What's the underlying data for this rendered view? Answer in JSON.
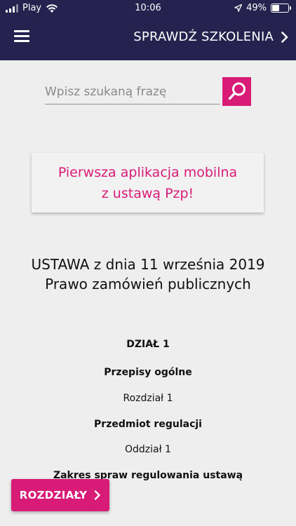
{
  "status_bar": {
    "carrier": "Play",
    "time": "10:06",
    "battery_percent": "49%",
    "battery_level": 0.49,
    "icons": [
      "signal-icon",
      "wifi-icon",
      "location-arrow-icon",
      "battery-icon"
    ]
  },
  "header": {
    "menu_icon": "hamburger-menu-icon",
    "check_trainings_label": "SPRAWDŹ SZKOLENIA",
    "chevron_icon": "chevron-right-icon"
  },
  "search": {
    "placeholder": "Wpisz szukaną frazę",
    "value": "",
    "button_icon": "search-icon"
  },
  "promo": {
    "line1": "Pierwsza aplikacja mobilna",
    "line2": "z ustawą Pzp!"
  },
  "document": {
    "title_line1": "USTAWA z dnia 11 września 2019",
    "title_line2": "Prawo zamówień publicznych",
    "section": "DZIAŁ 1",
    "section_title": "Przepisy ogólne",
    "chapter": "Rozdział 1",
    "chapter_title": "Przedmiot regulacji",
    "division": "Oddział 1",
    "division_title": "Zakres spraw regulowania ustawą"
  },
  "chapters_button": {
    "label": "ROZDZIAŁY"
  },
  "colors": {
    "header_bg": "#25224f",
    "accent": "#d81b76",
    "page_bg": "#efeeee"
  }
}
